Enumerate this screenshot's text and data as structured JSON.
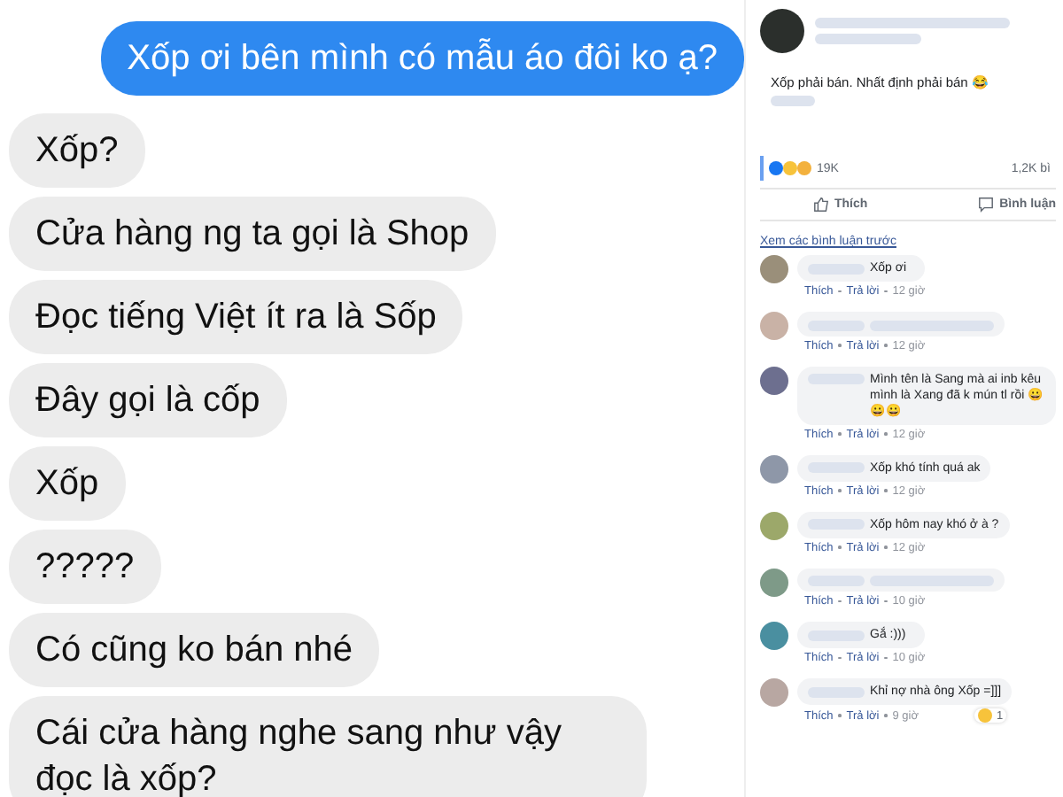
{
  "chat": {
    "messages": [
      {
        "kind": "sent",
        "text": "Xốp ơi bên mình có mẫu áo đôi ko ạ?"
      },
      {
        "kind": "received",
        "text": "Xốp?"
      },
      {
        "kind": "received",
        "text": "Cửa hàng ng ta gọi là Shop"
      },
      {
        "kind": "received",
        "text": "Đọc tiếng Việt ít ra là Sốp"
      },
      {
        "kind": "received",
        "text": "Đây gọi là cốp"
      },
      {
        "kind": "received",
        "text": "Xốp"
      },
      {
        "kind": "received",
        "text": "?????"
      },
      {
        "kind": "received",
        "text": "Có cũng ko bán nhé"
      },
      {
        "kind": "received",
        "text": "Cái cửa hàng nghe sang như vậy đọc là xốp?"
      }
    ]
  },
  "post": {
    "text": "Xốp phải bán. Nhất định phải bán 😂",
    "reaction_count": "19K",
    "comment_count": "1,2K bì",
    "like_label": "Thích",
    "comment_label": "Bình luận",
    "previous_comments_link": "Xem các bình luận trước",
    "comments": [
      {
        "text": "Xốp ơi",
        "like": "Thích",
        "reply": "Trả lời",
        "time": "12 giờ"
      },
      {
        "like": "Thích",
        "reply": "Trả lời",
        "time": "12 giờ"
      },
      {
        "text": "Mình tên là Sang mà ai inb kêu mình là Xang đã k mún tl rồi 😀😀😀",
        "like": "Thích",
        "reply": "Trả lời",
        "time": "12 giờ"
      },
      {
        "text": "Xốp khó tính quá ak",
        "like": "Thích",
        "reply": "Trả lời",
        "time": "12 giờ"
      },
      {
        "text": "Xốp hôm nay khó ở à ?",
        "like": "Thích",
        "reply": "Trả lời",
        "time": "12 giờ"
      },
      {
        "like": "Thích",
        "reply": "Trả lời",
        "time": "10 giờ"
      },
      {
        "text": "Gắ :)))",
        "like": "Thích",
        "reply": "Trả lời",
        "time": "10 giờ"
      },
      {
        "text": "Khỉ nợ nhà ông Xốp =]]]",
        "like": "Thích",
        "reply": "Trả lời",
        "time": "9 giờ",
        "reaction": "1"
      }
    ]
  }
}
